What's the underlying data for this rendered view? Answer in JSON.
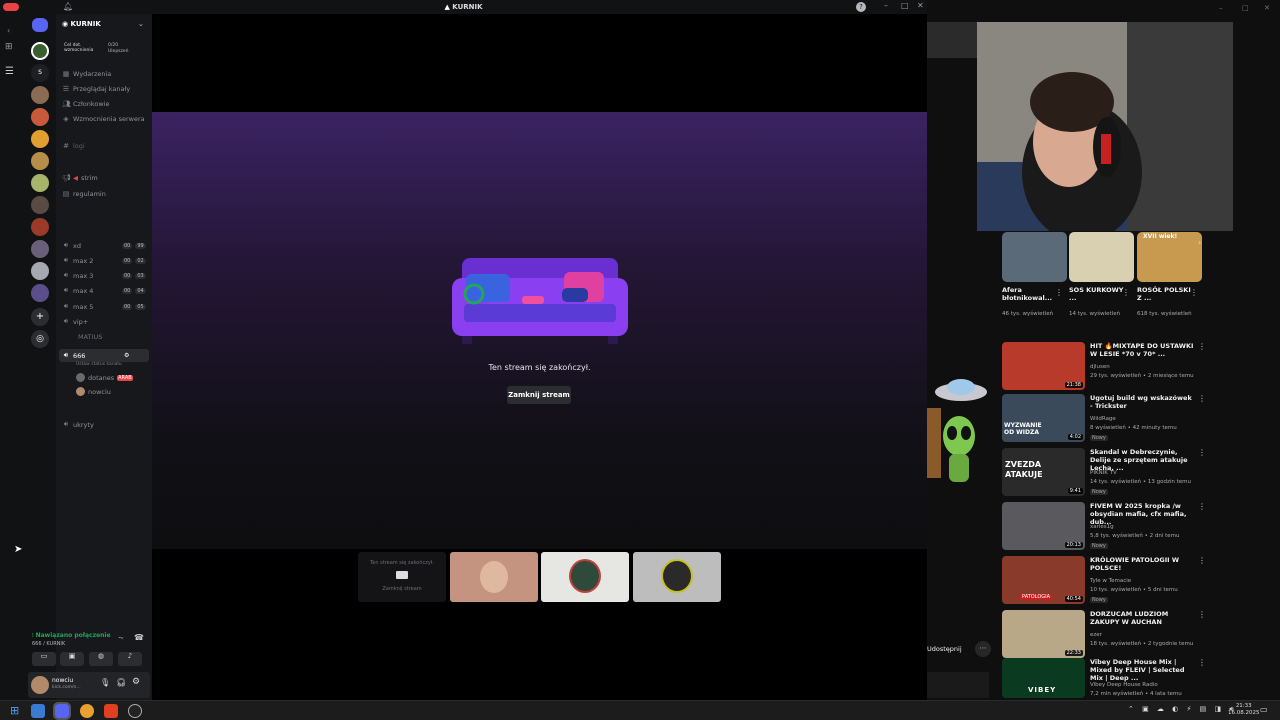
{
  "discord": {
    "window_title": "KURNIK",
    "server_name": "KURNIK",
    "boost": {
      "goal_label": "Cel dot. wzmocnienia",
      "count": "0/20",
      "status": "Ulepszeń"
    },
    "menu": [
      "Wydarzenia",
      "Przeglądaj kanały",
      "Członkowie",
      "Wzmocnienia serwera"
    ],
    "categories": {
      "logi": "logi"
    },
    "text_channels": [
      "strim",
      "regulamin"
    ],
    "voice_channels": [
      {
        "name": "xd",
        "c1": "00",
        "c2": "99"
      },
      {
        "name": "max 2",
        "c1": "00",
        "c2": "02"
      },
      {
        "name": "max 3",
        "c1": "00",
        "c2": "03"
      },
      {
        "name": "max 4",
        "c1": "00",
        "c2": "04"
      },
      {
        "name": "max 5",
        "c1": "00",
        "c2": "05"
      }
    ],
    "vip_channel": "vip+",
    "vip_member": "MATIUS",
    "active_channel": "666",
    "active_channel_status": "Ustaw status kanału",
    "members": [
      "dotanes",
      "nowciu"
    ],
    "member_tag": "ARAB",
    "hidden_channel": "ukryty",
    "stream_ended_text": "Ten stream się zakończył.",
    "close_stream_label": "Zamknij stream",
    "mini_tile_text": "Ten stream się zakończył.",
    "mini_tile_button": "Zamknij stream",
    "connection_status": "Nawiązano połączenie",
    "connection_channel": "666 / KURNIK",
    "username": "nowciu",
    "user_status": "kick.com/n..."
  },
  "youtube": {
    "shorts": [
      {
        "title": "Afera błotnikowal...",
        "views": "46 tys. wyświetleń"
      },
      {
        "title": "SOS KURKOWY ...",
        "views": "14 tys. wyświetleń"
      },
      {
        "title": "ROSÓŁ POLSKI Z ...",
        "views": "618 tys. wyświetleń"
      }
    ],
    "shorts_overlay": "XVII wiek!",
    "share_label": "Udostępnij",
    "videos": [
      {
        "title": "HIT 🔥MIXTAPE DO USTAWKI W LESIE *70 v 70* ...",
        "channel": "djlusen",
        "meta": "29 tys. wyświetleń • 2 miesiące temu",
        "duration": "21:38",
        "new": ""
      },
      {
        "title": "Ugotuj build wg wskazówek - Trickster",
        "channel": "WildRage",
        "meta": "8 wyświetleń • 42 minuty temu",
        "duration": "4:02",
        "new": "Nowy",
        "thumb_text": "WYZWANIE OD WIDZA"
      },
      {
        "title": "Skandal w Debreczynie, Delije ze sprzętem atakuje Lecha, ...",
        "channel": "PIKNIK TV",
        "meta": "14 tys. wyświetleń • 13 godzin temu",
        "duration": "9:41",
        "new": "Nowy",
        "thumb_text": "ZVEZDA ATAKUJE"
      },
      {
        "title": "FIVEM W 2025 kropka /w obsydian mafia, cfx mafia, dub...",
        "channel": "xaries1g",
        "meta": "5,8 tys. wyświetleń • 2 dni temu",
        "duration": "20:13",
        "new": "Nowy"
      },
      {
        "title": "KRÓLOWIE PATOLOGII W POLSCE!",
        "channel": "Tyle w Temacie",
        "meta": "10 tys. wyświetleń • 5 dni temu",
        "duration": "40:54",
        "new": "Nowy",
        "thumb_text": "PATOLOGIA"
      },
      {
        "title": "DORZUCAM LUDZIOM ZAKUPY W AUCHAN",
        "channel": "ezer",
        "meta": "18 tys. wyświetleń • 2 tygodnie temu",
        "duration": "22:33",
        "new": ""
      },
      {
        "title": "Vibey Deep House Mix | Mixed by FLEIV | Selected Mix | Deep ...",
        "channel": "Vibey Deep House Radio",
        "meta": "7,2 mln wyświetleń • 4 lata temu",
        "duration": "",
        "new": "",
        "thumb_text": "VIBEY"
      }
    ]
  },
  "taskbar": {
    "time": "21:33",
    "date": "16.08.2025"
  },
  "colors": {
    "accent": "#5865f2",
    "online": "#23a55a",
    "stream_purple": "#3b2362",
    "live_red": "#ed4245"
  }
}
